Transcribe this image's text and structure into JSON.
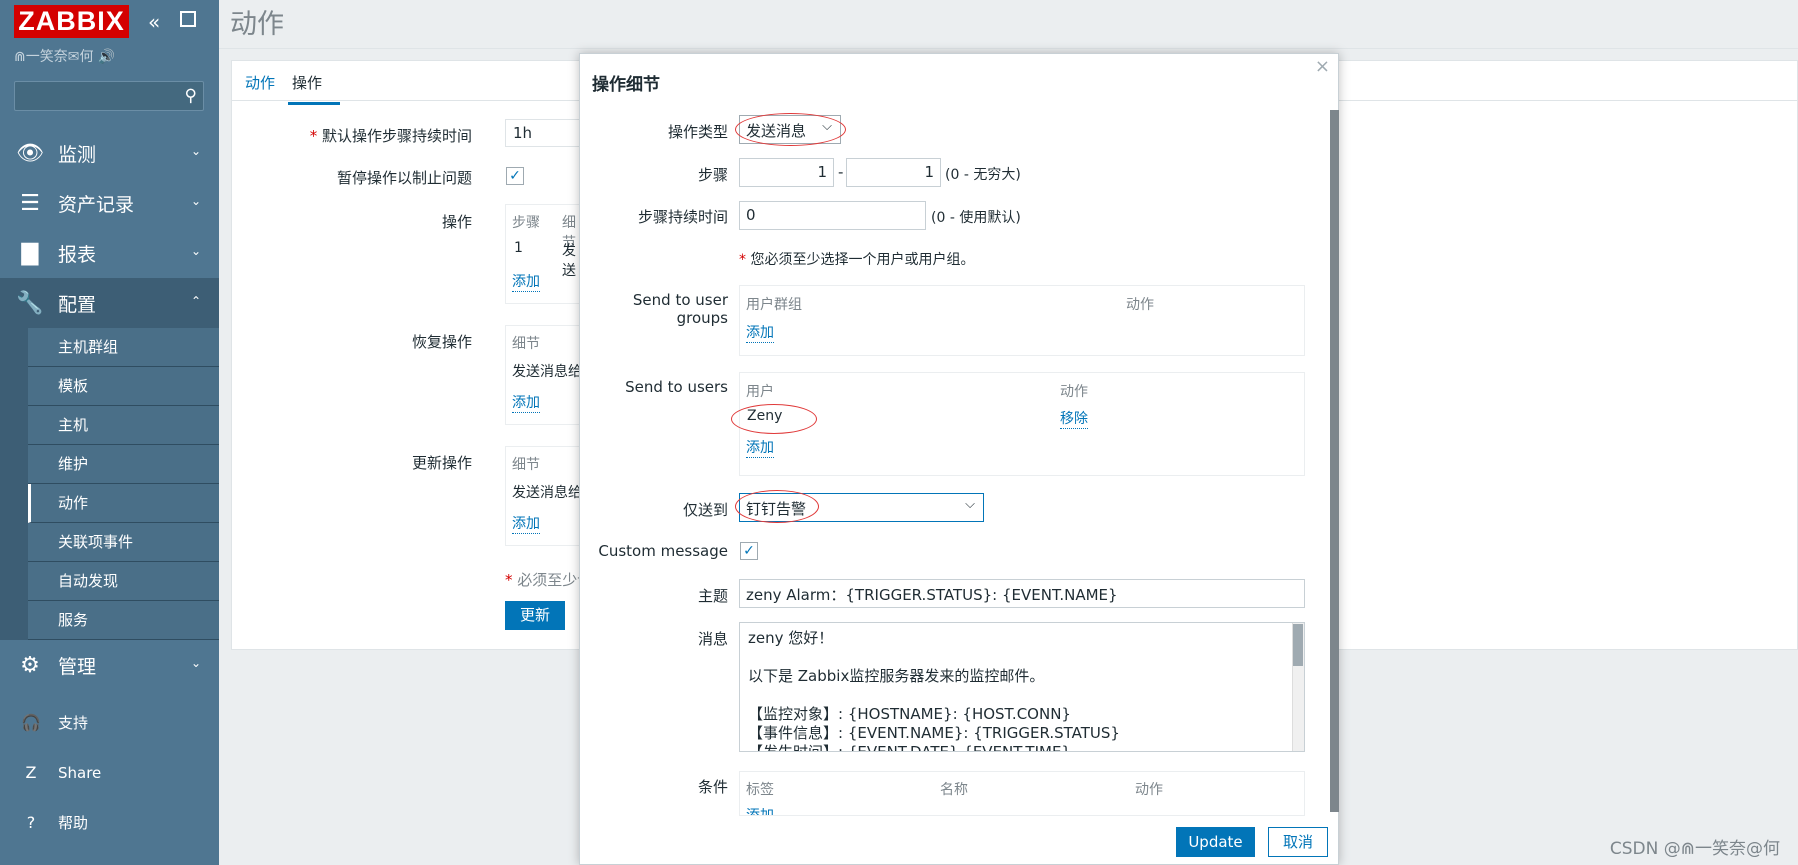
{
  "app": {
    "logo": "ZABBIX",
    "user_line": "⋒一笑奈✉何 🔊"
  },
  "menu": [
    {
      "icon": "eye-icon",
      "glyph": "👁",
      "label": "监测",
      "chevron": "⌄"
    },
    {
      "icon": "list-icon",
      "glyph": "☰",
      "label": "资产记录",
      "chevron": "⌄"
    },
    {
      "icon": "bar-chart-icon",
      "glyph": "▇",
      "label": "报表",
      "chevron": "⌄"
    },
    {
      "icon": "wrench-icon",
      "glyph": "🔧",
      "label": "配置",
      "chevron": "⌃"
    }
  ],
  "submenu": [
    "主机群组",
    "模板",
    "主机",
    "维护",
    "动作",
    "关联项事件",
    "自动发现",
    "服务"
  ],
  "admin": {
    "label": "管理",
    "chevron": "⌄"
  },
  "bottom": [
    {
      "label": "支持",
      "glyph": "🎧"
    },
    {
      "label": "Share",
      "glyph": "Z"
    },
    {
      "label": "帮助",
      "glyph": "?"
    }
  ],
  "page": {
    "title": "动作"
  },
  "tabs": [
    "动作",
    "操作"
  ],
  "bg_form": {
    "duration_label": "默认操作步骤持续时间",
    "duration_value": "1h",
    "pause_label": "暂停操作以制止问题",
    "ops_label": "操作",
    "ops_col_step": "步骤",
    "ops_col_detail": "细节",
    "ops_row_step": "1",
    "ops_row_detail": "发送",
    "add": "添加",
    "recovery_label": "恢复操作",
    "update_label": "更新操作",
    "detail_col": "细节",
    "detail_row": "发送消息给",
    "required_note": "必须至少设",
    "btn_update": "更新"
  },
  "modal": {
    "title": "操作细节",
    "op_type_label": "操作类型",
    "op_type_value": "发送消息",
    "steps_label": "步骤",
    "step_from": "1",
    "step_to": "1",
    "steps_hint": "(0 - 无穷大)",
    "step_duration_label": "步骤持续时间",
    "step_duration_value": "0",
    "step_duration_hint": "(0 - 使用默认)",
    "required_text": "您必须至少选择一个用户或用户组。",
    "user_groups_label": "Send to user groups",
    "ug_col_group": "用户群组",
    "ug_col_action": "动作",
    "add": "添加",
    "users_label": "Send to users",
    "u_col_user": "用户",
    "u_col_action": "动作",
    "user_name": "Zeny",
    "remove": "移除",
    "send_only_label": "仅送到",
    "send_only_value": "钉钉告警",
    "custom_message_label": "Custom message",
    "subject_label": "主题",
    "subject_value": "zeny Alarm：{TRIGGER.STATUS}: {EVENT.NAME}",
    "message_label": "消息",
    "message_lines": [
      "zeny 您好！",
      "",
      "以下是 Zabbix监控服务器发来的监控邮件。",
      "",
      "【监控对象】: {HOSTNAME}: {HOST.CONN}",
      "【事件信息】: {EVENT.NAME}: {TRIGGER.STATUS}",
      "【发生时间】: {EVENT.DATE} {EVENT.TIME}"
    ],
    "conditions_label": "条件",
    "cond_col_tag": "标签",
    "cond_col_name": "名称",
    "cond_col_action": "动作",
    "btn_update": "Update",
    "btn_cancel": "取消"
  },
  "watermark": "CSDN @⋒一笑奈@何",
  "colors": {
    "sidebar": "#4f7691",
    "accent": "#0275b8",
    "logo": "#d40000",
    "annotation": "#e03a3a"
  }
}
